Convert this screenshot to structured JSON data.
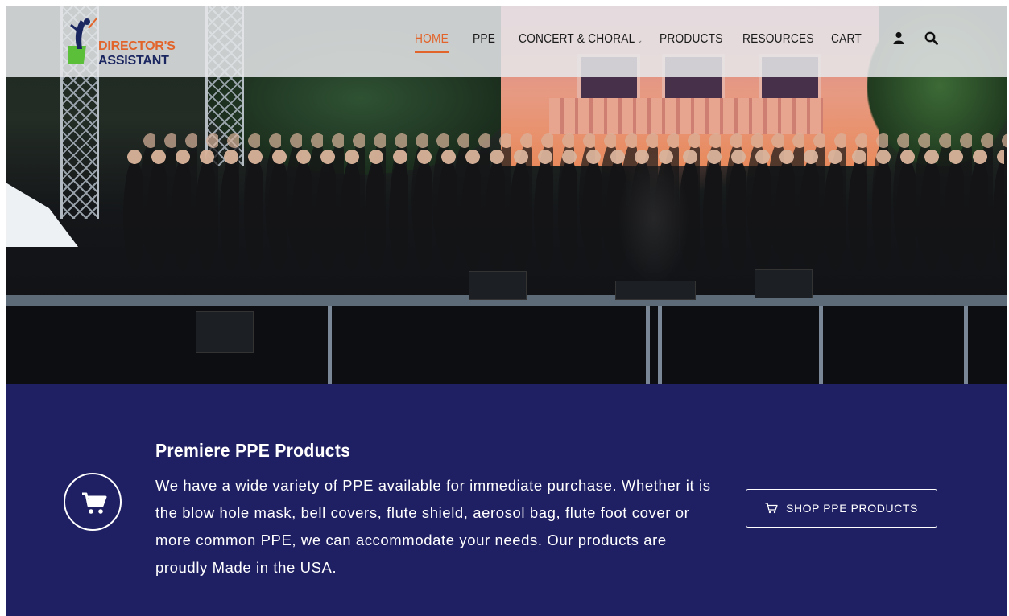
{
  "brand": {
    "line1": "DIRECTOR'S",
    "line2": "ASSISTANT",
    "accent_color": "#e2642a",
    "navy_color": "#1a2660"
  },
  "nav": {
    "items": [
      {
        "label": "HOME",
        "active": true
      },
      {
        "label": "PPE"
      },
      {
        "label": "CONCERT & CHORAL",
        "has_dropdown": true
      },
      {
        "label": "PRODUCTS"
      },
      {
        "label": "RESOURCES"
      },
      {
        "label": "CART"
      }
    ],
    "dropdown_glyph": "⌄",
    "icons": [
      "user-icon",
      "search-icon"
    ]
  },
  "hero": {
    "icon": "hero-photo"
  },
  "promo": {
    "background": "#1f1f63",
    "title": "Premiere PPE Products",
    "body": "We have a wide variety of PPE available for immediate purchase. Whether it is the blow hole mask, bell covers, flute shield, aerosol bag, flute foot cover or more common PPE, we can accommodate your needs. Our products are proudly Made in the USA.",
    "cta_label": "SHOP PPE PRODUCTS",
    "cta_icon": "cart-icon",
    "feature_icon": "cart-icon"
  }
}
